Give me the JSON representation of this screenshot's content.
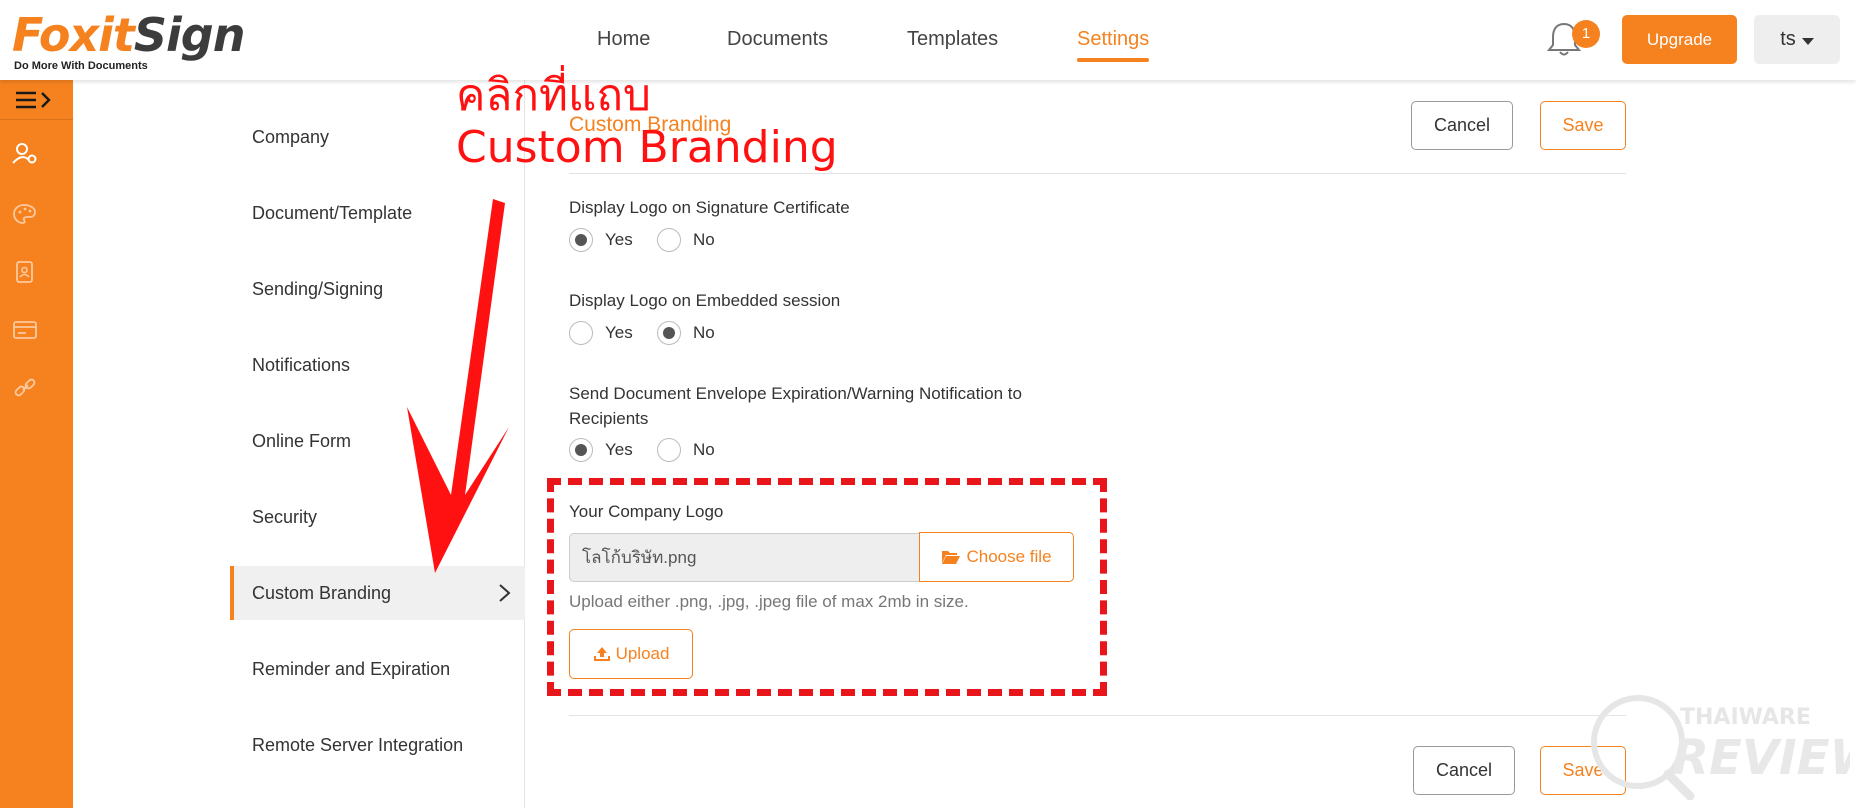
{
  "brand": {
    "logo_main": "Foxit",
    "logo_sign": "Sign",
    "tagline": "Do More With Documents"
  },
  "nav": {
    "tabs": [
      {
        "label": "Home"
      },
      {
        "label": "Documents"
      },
      {
        "label": "Templates"
      },
      {
        "label": "Settings",
        "active": true
      }
    ],
    "notification_count": "1",
    "upgrade_label": "Upgrade",
    "user_label": "ts"
  },
  "rail": {
    "icons": [
      "menu-toggle-icon",
      "user-settings-icon",
      "palette-icon",
      "contacts-icon",
      "billing-card-icon",
      "link-icon"
    ]
  },
  "submenu": {
    "items": [
      {
        "label": "Company"
      },
      {
        "label": "Document/Template"
      },
      {
        "label": "Sending/Signing"
      },
      {
        "label": "Notifications"
      },
      {
        "label": "Online Form"
      },
      {
        "label": "Security"
      },
      {
        "label": "Custom Branding",
        "active": true
      },
      {
        "label": "Reminder and Expiration"
      },
      {
        "label": "Remote Server Integration"
      }
    ]
  },
  "main": {
    "section_title": "Custom Branding",
    "cancel_label": "Cancel",
    "save_label": "Save",
    "options": [
      {
        "label": "Display Logo on Signature Certificate",
        "yes": "Yes",
        "no": "No",
        "selected": "Yes"
      },
      {
        "label": "Display Logo on Embedded session",
        "yes": "Yes",
        "no": "No",
        "selected": "No"
      },
      {
        "label_line1": "Send Document Envelope Expiration/Warning Notification to",
        "label_line2": "Recipients",
        "yes": "Yes",
        "no": "No",
        "selected": "Yes"
      }
    ],
    "logo_field": {
      "label": "Your Company Logo",
      "filename": "โลโก้บริษัท.png",
      "choose_label": "Choose file",
      "hint": "Upload either .png, .jpg, .jpeg file of max 2mb in size.",
      "upload_label": "Upload"
    }
  },
  "annotation": {
    "line1": "คลิกที่แถบ",
    "line2": "Custom Branding",
    "color": "#ff1111"
  },
  "colors": {
    "accent": "#f5821f"
  }
}
